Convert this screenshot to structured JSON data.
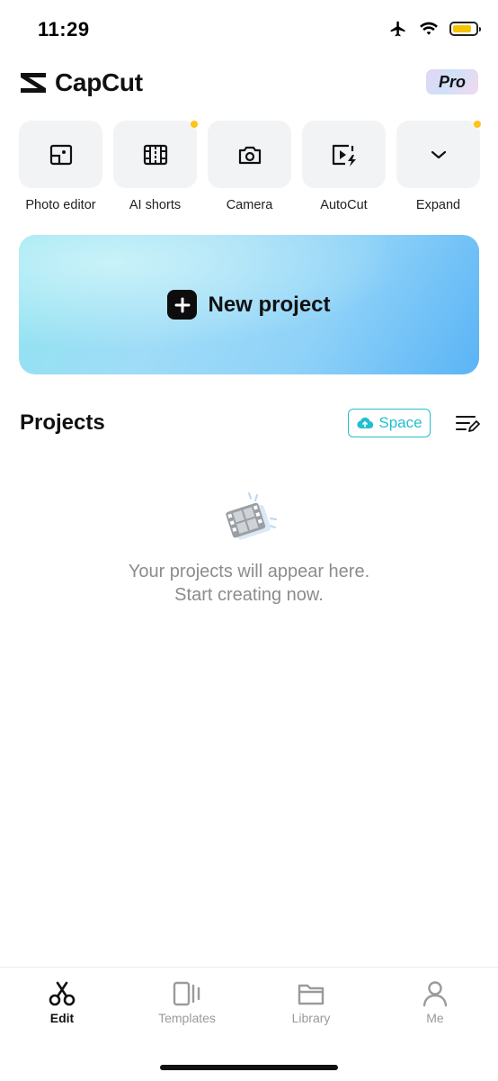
{
  "status_bar": {
    "time": "11:29",
    "battery_level": 0.85
  },
  "header": {
    "app_name": "CapCut",
    "pro_label": "Pro"
  },
  "tools": [
    {
      "label": "Photo editor",
      "icon": "photo-editor-icon",
      "badge": false
    },
    {
      "label": "AI shorts",
      "icon": "ai-shorts-icon",
      "badge": true
    },
    {
      "label": "Camera",
      "icon": "camera-icon",
      "badge": false
    },
    {
      "label": "AutoCut",
      "icon": "autocut-icon",
      "badge": false
    },
    {
      "label": "Expand",
      "icon": "chevron-down-icon",
      "badge": true
    }
  ],
  "new_project": {
    "label": "New project"
  },
  "projects": {
    "title": "Projects",
    "space_label": "Space",
    "empty_line1": "Your projects will appear here.",
    "empty_line2": "Start creating now."
  },
  "bottom_nav": [
    {
      "label": "Edit",
      "icon": "scissors-icon",
      "active": true
    },
    {
      "label": "Templates",
      "icon": "templates-icon",
      "active": false
    },
    {
      "label": "Library",
      "icon": "folder-icon",
      "active": false
    },
    {
      "label": "Me",
      "icon": "person-icon",
      "active": false
    }
  ],
  "colors": {
    "accent": "#22bfcf",
    "badge_dot": "#ffc21a",
    "banner_start": "#8fe4f0",
    "banner_end": "#5ab4f6",
    "muted_text": "#8c8c8c"
  }
}
